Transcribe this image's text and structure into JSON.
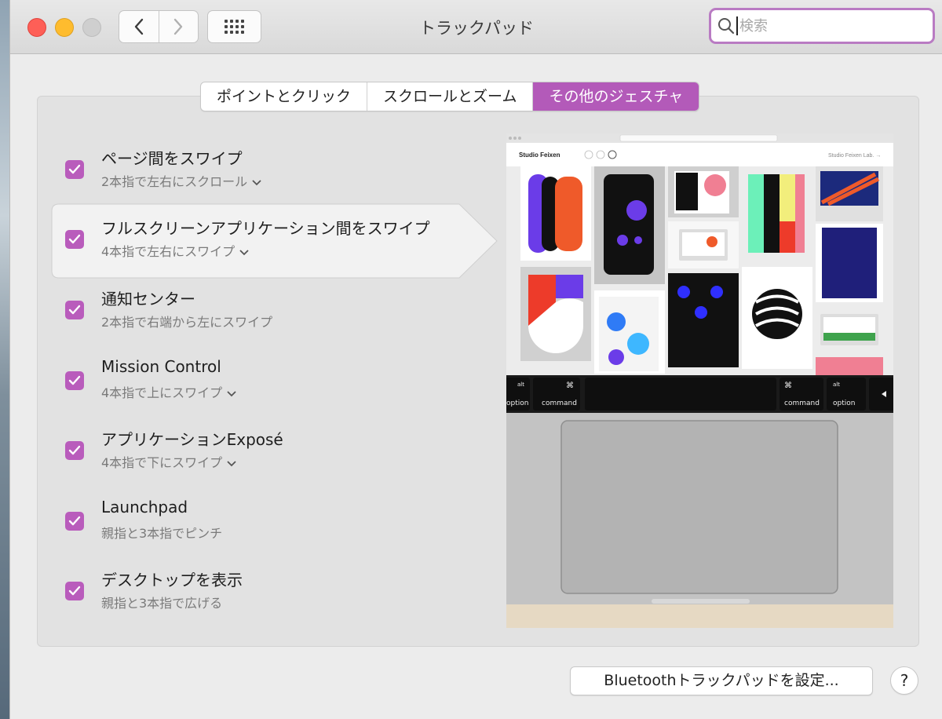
{
  "window": {
    "title": "トラックパッド",
    "search_placeholder": "検索"
  },
  "tabs": [
    {
      "label": "ポイントとクリック",
      "active": false
    },
    {
      "label": "スクロールとズーム",
      "active": false
    },
    {
      "label": "その他のジェスチャ",
      "active": true
    }
  ],
  "gestures": [
    {
      "title": "ページ間をスワイプ",
      "desc": "2本指で左右にスクロール",
      "has_dropdown": true,
      "checked": true
    },
    {
      "title": "フルスクリーンアプリケーション間をスワイプ",
      "desc": "4本指で左右にスワイプ",
      "has_dropdown": true,
      "checked": true,
      "selected": true
    },
    {
      "title": "通知センター",
      "desc": "2本指で右端から左にスワイプ",
      "has_dropdown": false,
      "checked": true
    },
    {
      "title": "Mission Control",
      "desc": "4本指で上にスワイプ",
      "has_dropdown": true,
      "checked": true
    },
    {
      "title": "アプリケーションExposé",
      "desc": "4本指で下にスワイプ",
      "has_dropdown": true,
      "checked": true
    },
    {
      "title": "Launchpad",
      "desc": "親指と3本指でピンチ",
      "has_dropdown": false,
      "checked": true
    },
    {
      "title": "デスクトップを表示",
      "desc": "親指と3本指で広げる",
      "has_dropdown": false,
      "checked": true
    }
  ],
  "preview": {
    "site_title": "Studio Feixen",
    "site_link": "Studio Feixen Lab. →",
    "keys": {
      "alt": "alt",
      "option": "option",
      "cmd_symbol": "⌘",
      "command": "command"
    }
  },
  "footer": {
    "bluetooth_button": "Bluetoothトラックパッドを設定...",
    "help": "?"
  },
  "colors": {
    "accent": "#b35ab9",
    "checkbox": "#b95cbc",
    "search_focus": "#b97bc3"
  }
}
